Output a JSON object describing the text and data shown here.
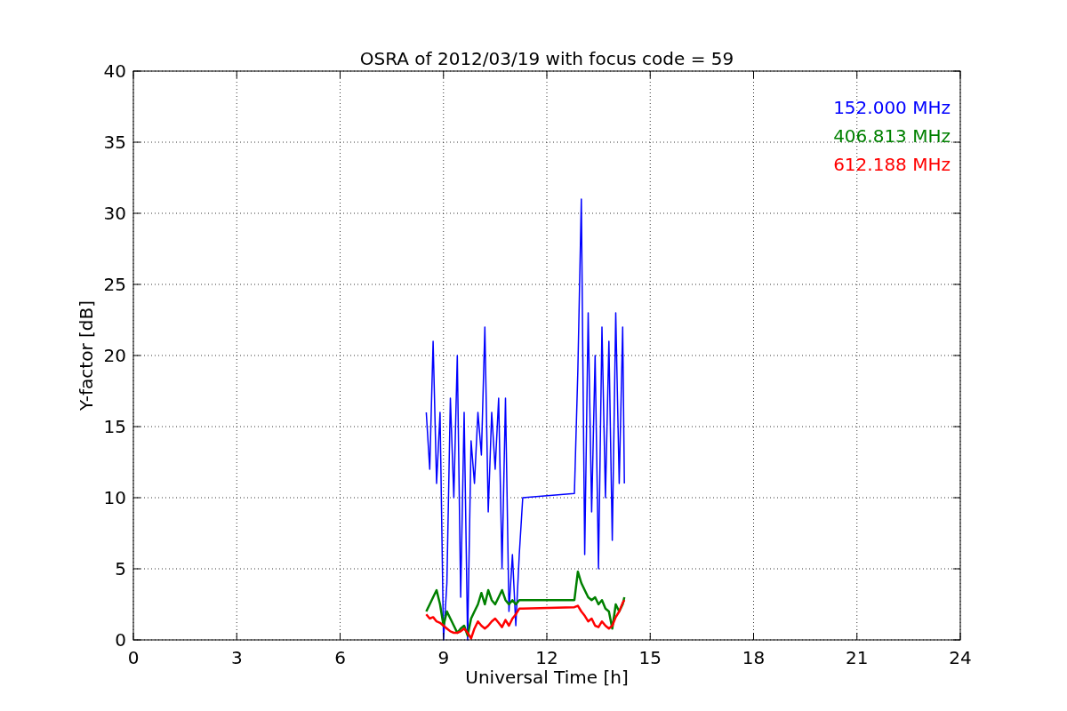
{
  "figure": {
    "chart_data": {
      "type": "line",
      "title": "OSRA of 2012/03/19 with focus code = 59",
      "xlabel": "Universal Time [h]",
      "ylabel": "Y-factor [dB]",
      "x": [
        8.5,
        8.6,
        8.7,
        8.8,
        8.9,
        9.0,
        9.1,
        9.2,
        9.3,
        9.4,
        9.5,
        9.6,
        9.7,
        9.8,
        9.9,
        10.0,
        10.1,
        10.2,
        10.3,
        10.4,
        10.5,
        10.6,
        10.7,
        10.8,
        10.9,
        11.0,
        11.1,
        11.2,
        11.3,
        12.8,
        12.9,
        13.0,
        13.1,
        13.2,
        13.3,
        13.4,
        13.5,
        13.6,
        13.7,
        13.8,
        13.9,
        14.0,
        14.1,
        14.2,
        14.25
      ],
      "series": [
        {
          "name": "152.000 MHz",
          "color": "#0000ff",
          "values": [
            16,
            12,
            21,
            11,
            16,
            0,
            4,
            17,
            10,
            20,
            3,
            16,
            0,
            14,
            11,
            16,
            13,
            22,
            9,
            16,
            12,
            17,
            5,
            17,
            2,
            6,
            1,
            6,
            10,
            10.3,
            19,
            31,
            6,
            23,
            9,
            20,
            5,
            22,
            10,
            21,
            7,
            23,
            11,
            22,
            11
          ]
        },
        {
          "name": "406.813 MHz",
          "color": "#008000",
          "values": [
            2,
            2.5,
            3,
            3.5,
            2.5,
            1,
            2,
            1.5,
            1,
            0.5,
            0.8,
            1,
            0.3,
            1.5,
            2,
            2.5,
            3.3,
            2.5,
            3.5,
            2.8,
            2.5,
            3,
            3.5,
            2.8,
            2.5,
            2.8,
            2.5,
            2.8,
            2.8,
            2.8,
            4.8,
            4,
            3.5,
            3,
            2.8,
            3,
            2.5,
            2.8,
            2.2,
            2,
            0.8,
            2.5,
            2,
            2.5,
            3
          ]
        },
        {
          "name": "612.188 MHz",
          "color": "#ff0000",
          "values": [
            1.8,
            1.5,
            1.6,
            1.3,
            1.2,
            1.0,
            0.8,
            0.6,
            0.5,
            0.5,
            0.6,
            0.8,
            0.5,
            0.1,
            0.8,
            1.3,
            1.0,
            0.8,
            1.0,
            1.3,
            1.5,
            1.2,
            0.9,
            1.4,
            1.0,
            1.5,
            1.8,
            2.2,
            2.2,
            2.3,
            2.4,
            2.0,
            1.7,
            1.3,
            1.5,
            1.0,
            0.9,
            1.3,
            1.0,
            0.8,
            1.0,
            1.6,
            2.0,
            2.6,
            2.8
          ]
        }
      ],
      "grid": true,
      "xlim": [
        0,
        24
      ],
      "ylim": [
        0,
        40
      ],
      "xticks": [
        0,
        3,
        6,
        9,
        12,
        15,
        18,
        21,
        24
      ],
      "yticks": [
        0,
        5,
        10,
        15,
        20,
        25,
        30,
        35,
        40
      ]
    }
  }
}
